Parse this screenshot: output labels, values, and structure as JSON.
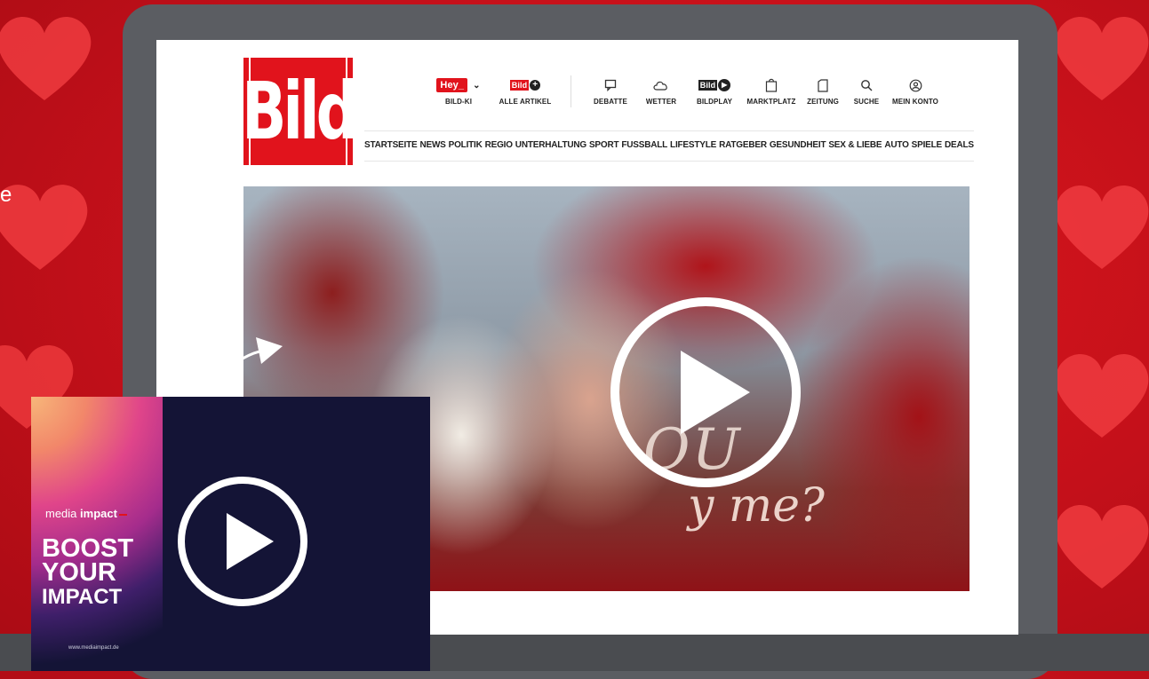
{
  "colors": {
    "brand_red": "#e1131c",
    "background_red": "#c4101a",
    "card_navy": "#141436"
  },
  "edge_text": "e",
  "site": {
    "logo_text": "Bild",
    "top_nav": [
      {
        "label": "BILD-KI",
        "icon": "hey-badge",
        "badge": "Hey_"
      },
      {
        "label": "ALLE ARTIKEL",
        "icon": "bild-plus-icon",
        "badge": "Bild"
      },
      {
        "label": "DEBATTE",
        "icon": "chat-icon"
      },
      {
        "label": "WETTER",
        "icon": "cloud-icon"
      },
      {
        "label": "BILDPLAY",
        "icon": "play-logo-icon",
        "badge": "Bild"
      },
      {
        "label": "MARKTPLATZ",
        "icon": "shopping-bag-icon"
      },
      {
        "label": "ZEITUNG",
        "icon": "newspaper-icon"
      },
      {
        "label": "SUCHE",
        "icon": "search-icon"
      },
      {
        "label": "MEIN KONTO",
        "icon": "user-icon"
      }
    ],
    "main_nav": [
      "STARTSEITE",
      "NEWS",
      "POLITIK",
      "REGIO",
      "UNTERHALTUNG",
      "SPORT",
      "FUSSBALL",
      "LIFESTYLE",
      "RATGEBER",
      "GESUNDHEIT",
      "SEX & LIEBE",
      "AUTO",
      "SPIELE",
      "DEALS"
    ]
  },
  "hero": {
    "neon_line1": "OU",
    "neon_line2": "y me?"
  },
  "card": {
    "brand_light": "media",
    "brand_bold": "impact",
    "headline_1": "BOOST",
    "headline_2": "YOUR",
    "headline_3": "IMPACT",
    "url": "www.mediaimpact.de"
  }
}
